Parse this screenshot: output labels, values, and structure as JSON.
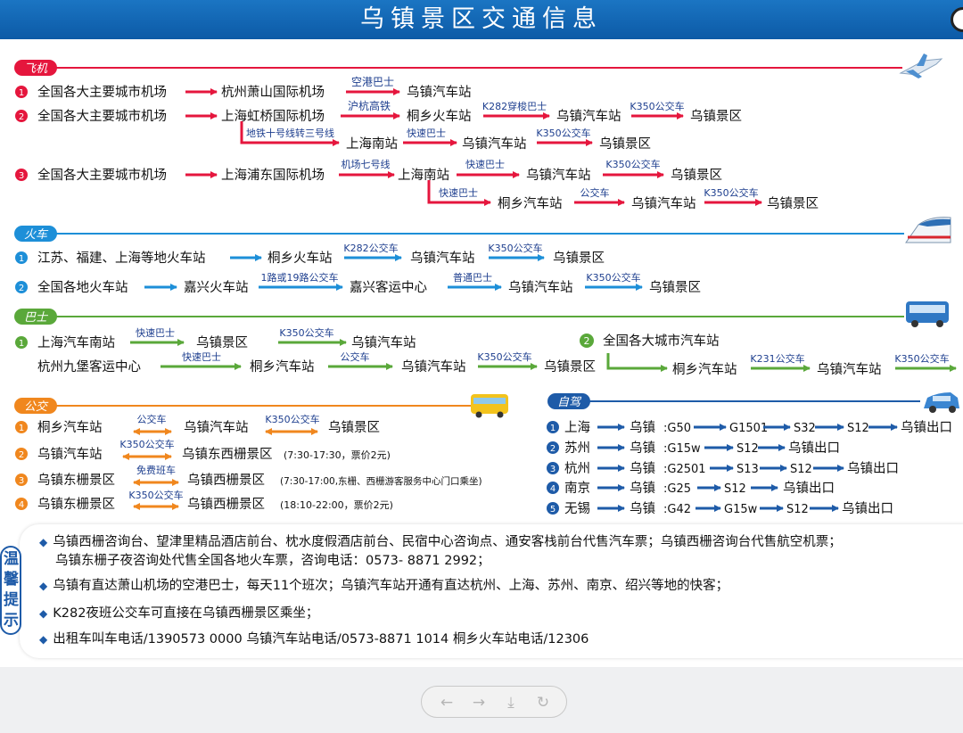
{
  "header": {
    "title": "乌镇景区交通信息"
  },
  "sections": {
    "flight": "飞机",
    "train": "火车",
    "bus": "巴士",
    "public": "公交",
    "drive": "自驾"
  },
  "numbers": [
    "1",
    "2",
    "3",
    "4",
    "5"
  ],
  "flight": {
    "r1": {
      "a": "全国各大主要城市机场",
      "b": "杭州萧山国际机场",
      "e1": "空港巴士",
      "c": "乌镇汽车站"
    },
    "r2": {
      "a": "全国各大主要城市机场",
      "b": "上海虹桥国际机场",
      "e1": "沪杭高铁",
      "c": "桐乡火车站",
      "e2": "K282穿梭巴士",
      "d": "乌镇汽车站",
      "e3": "K350公交车",
      "f": "乌镇景区"
    },
    "r2b": {
      "e0": "地铁十号线转三号线",
      "a": "上海南站",
      "e1": "快速巴士",
      "b": "乌镇汽车站",
      "e2": "K350公交车",
      "c": "乌镇景区"
    },
    "r3": {
      "a": "全国各大主要城市机场",
      "b": "上海浦东国际机场",
      "e1": "机场七号线",
      "c": "上海南站",
      "e2": "快速巴士",
      "d": "乌镇汽车站",
      "e3": "K350公交车",
      "f": "乌镇景区"
    },
    "r3b": {
      "e1": "快速巴士",
      "a": "桐乡汽车站",
      "e2": "公交车",
      "b": "乌镇汽车站",
      "e3": "K350公交车",
      "c": "乌镇景区"
    }
  },
  "train": {
    "r1": {
      "a": "江苏、福建、上海等地火车站",
      "b": "桐乡火车站",
      "e1": "K282公交车",
      "c": "乌镇汽车站",
      "e2": "K350公交车",
      "d": "乌镇景区"
    },
    "r2": {
      "a": "全国各地火车站",
      "b": "嘉兴火车站",
      "e1": "1路或19路公交车",
      "c": "嘉兴客运中心",
      "e2": "普通巴士",
      "d": "乌镇汽车站",
      "e3": "K350公交车",
      "f": "乌镇景区"
    }
  },
  "bus": {
    "r1": {
      "a": "上海汽车南站",
      "e1": "快速巴士",
      "b": "乌镇汽车站",
      "e2": "K350公交车",
      "c": "乌镇景区"
    },
    "r1b": {
      "a": "杭州九堡客运中心",
      "e1": "快速巴士",
      "b": "桐乡汽车站",
      "e2": "公交车",
      "c": "乌镇汽车站",
      "e3": "K350公交车",
      "d": "乌镇景区"
    },
    "r2": {
      "a": "全国各大城市汽车站",
      "b": "桐乡汽车站",
      "e1": "K231公交车",
      "c": "乌镇汽车站",
      "e2": "K350公交车"
    }
  },
  "public": {
    "r1": {
      "a": "桐乡汽车站",
      "e1": "公交车",
      "b": "乌镇汽车站",
      "e2": "K350公交车",
      "c": "乌镇景区"
    },
    "r2": {
      "a": "乌镇汽车站",
      "e1": "K350公交车",
      "b": "乌镇东西栅景区",
      "n": "(7:30-17:30，票价2元)"
    },
    "r3": {
      "a": "乌镇东栅景区",
      "e1": "免费班车",
      "b": "乌镇西栅景区",
      "n": "(7:30-17:00,东栅、西栅游客服务中心门口乘坐)"
    },
    "r4": {
      "a": "乌镇东栅景区",
      "e1": "K350公交车",
      "b": "乌镇西栅景区",
      "n": "(18:10-22:00，票价2元)"
    }
  },
  "drive": {
    "dest": "乌镇",
    "r1": {
      "a": "上海",
      "h": [
        ":G50",
        "G1501",
        "S32",
        "S12"
      ],
      "end": "乌镇出口"
    },
    "r2": {
      "a": "苏州",
      "h": [
        ":G15w",
        "S12"
      ],
      "end": "乌镇出口"
    },
    "r3": {
      "a": "杭州",
      "h": [
        ":G2501",
        "S13",
        "S12"
      ],
      "end": "乌镇出口"
    },
    "r4": {
      "a": "南京",
      "h": [
        ":G25",
        "S12"
      ],
      "end": "乌镇出口"
    },
    "r5": {
      "a": "无锡",
      "h": [
        ":G42",
        "G15w",
        "S12"
      ],
      "end": "乌镇出口"
    }
  },
  "tips": {
    "label": "温馨提示",
    "t1a": "乌镇西栅咨询台、望津里精品酒店前台、枕水度假酒店前台、民宿中心咨询点、通安客栈前台代售汽车票；乌镇西栅咨询台代售航空机票；",
    "t1b": "乌镇东栅子夜咨询处代售全国各地火车票，咨询电话：0573- 8871 2992；",
    "t2": "乌镇有直达萧山机场的空港巴士，每天11个班次；乌镇汽车站开通有直达杭州、上海、苏州、南京、绍兴等地的快客；",
    "t3": "K282夜班公交车可直接在乌镇西栅景区乘坐；",
    "t4": "出租车叫车电话/1390573 0000  乌镇汽车站电话/0573-8871 1014  桐乡火车站电话/12306"
  },
  "toolbar": {
    "prev": "←",
    "next": "→",
    "download": "⤓",
    "refresh": "↻"
  },
  "colors": {
    "header": "#1b75c3",
    "flight": "#e5163d",
    "train": "#1d8fd8",
    "bus": "#5aa83a",
    "public": "#f0871e",
    "drive": "#1e5ba8",
    "label": "#1e3f8f"
  }
}
